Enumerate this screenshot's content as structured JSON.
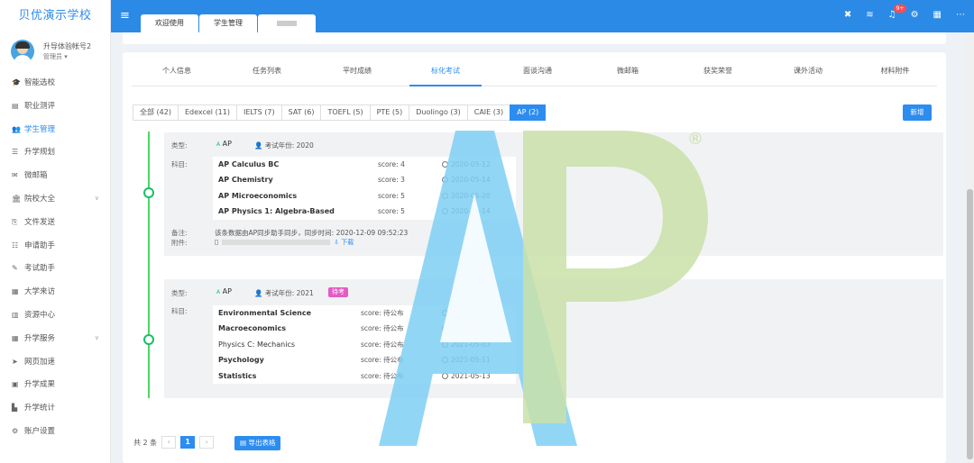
{
  "sidebar": {
    "brand": "贝优演示学校",
    "user_name": "升导体验帐号2",
    "user_role": "管理员 ▾",
    "items": [
      {
        "label": "智能选校",
        "icon": "graduation-cap-icon",
        "glyph": "🎓"
      },
      {
        "label": "职业测评",
        "icon": "clipboard-icon",
        "glyph": "▤"
      },
      {
        "label": "学生管理",
        "icon": "users-icon",
        "glyph": "👥"
      },
      {
        "label": "升学规划",
        "icon": "list-icon",
        "glyph": "☰"
      },
      {
        "label": "微邮箱",
        "icon": "mail-icon",
        "glyph": "✉"
      },
      {
        "label": "院校大全",
        "icon": "building-icon",
        "glyph": "🏛"
      },
      {
        "label": "文件发送",
        "icon": "file-send-icon",
        "glyph": "⎘"
      },
      {
        "label": "申请助手",
        "icon": "checklist-icon",
        "glyph": "☷"
      },
      {
        "label": "考试助手",
        "icon": "edit-icon",
        "glyph": "✎"
      },
      {
        "label": "大学来访",
        "icon": "calendar-icon",
        "glyph": "▦"
      },
      {
        "label": "资源中心",
        "icon": "resource-icon",
        "glyph": "▥"
      },
      {
        "label": "升学服务",
        "icon": "grid-icon",
        "glyph": "▦"
      },
      {
        "label": "网页加速",
        "icon": "send-icon",
        "glyph": "➤"
      },
      {
        "label": "升学成果",
        "icon": "id-card-icon",
        "glyph": "▣"
      },
      {
        "label": "升学统计",
        "icon": "bar-chart-icon",
        "glyph": "▙"
      },
      {
        "label": "账户设置",
        "icon": "gear-icon",
        "glyph": "⚙"
      }
    ]
  },
  "topbar": {
    "tabs": [
      "欢迎使用",
      "学生管理"
    ],
    "notification_badge": "9+"
  },
  "profile_tabs": [
    "个人信息",
    "任务列表",
    "平时成绩",
    "标化考试",
    "面谈沟通",
    "微邮箱",
    "获奖荣誉",
    "课外活动",
    "材料附件"
  ],
  "filters": [
    "全部 (42)",
    "Edexcel (11)",
    "IELTS (7)",
    "SAT (6)",
    "TOEFL (5)",
    "PTE (5)",
    "Duolingo (3)",
    "CAIE (3)",
    "AP (2)"
  ],
  "add_label": "新增",
  "labels": {
    "type": "类型:",
    "subjects": "科目:",
    "remark": "备注:",
    "attachment": "附件:",
    "download": "⇩ 下载"
  },
  "records": [
    {
      "type": "AP",
      "year": "考试年份: 2020",
      "remark": "该条数据由AP同步助手同步，同步时间: 2020-12-09 09:52:23",
      "subjects": [
        {
          "name": "AP Calculus BC",
          "score": "score: 4",
          "date": "2020-05-12"
        },
        {
          "name": "AP Chemistry",
          "score": "score: 3",
          "date": "2020-05-14"
        },
        {
          "name": "AP Microeconomics",
          "score": "score: 5",
          "date": "2020-05-20"
        },
        {
          "name": "AP Physics 1: Algebra-Based",
          "score": "score: 5",
          "date": "2020-05-14"
        }
      ]
    },
    {
      "type": "AP",
      "year": "考试年份: 2021",
      "tag": "待考",
      "subjects": [
        {
          "name": "Environmental Science",
          "score": "score: 待公布",
          "date": "2021-05-14"
        },
        {
          "name": "Macroeconomics",
          "score": "score: 待公布",
          "date": "2021-05-10"
        },
        {
          "name": "Physics C: Mechanics",
          "score": "score: 待公布",
          "date": "2021-05-03"
        },
        {
          "name": "Psychology",
          "score": "score: 待公布",
          "date": "2021-05-11"
        },
        {
          "name": "Statistics",
          "score": "score: 待公布",
          "date": "2021-05-13"
        }
      ]
    }
  ],
  "pager": {
    "total": "共 2 条",
    "prev": "‹",
    "current": "1",
    "next": "›",
    "export": "导出表格"
  },
  "watermark": {
    "text": "AP",
    "registered": "®",
    "color_a": "#7fcff5",
    "color_p": "#c9e0a8"
  },
  "colors": {
    "accent": "#2d8cf0",
    "timeline": "#19be6b",
    "tag": "#e55ac3"
  }
}
